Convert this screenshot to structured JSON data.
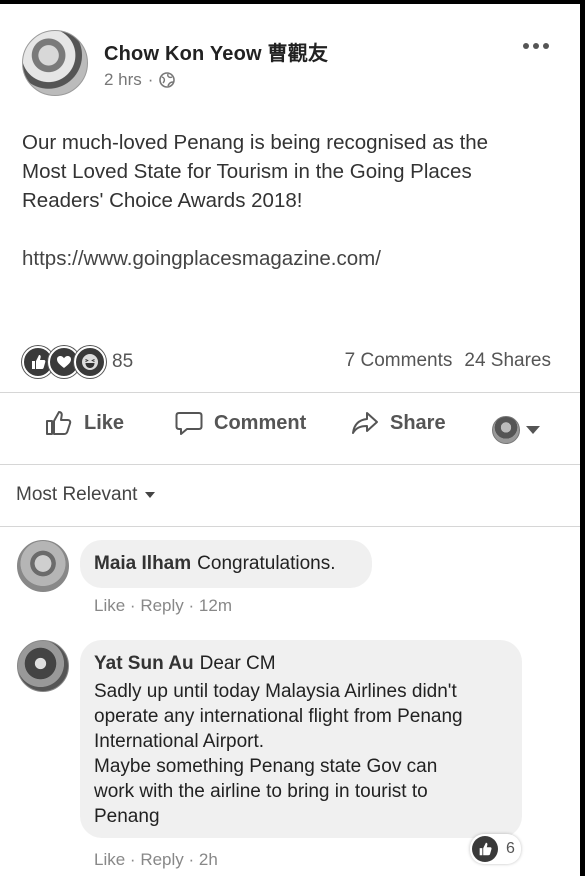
{
  "post": {
    "author": "Chow Kon Yeow 曹觀友",
    "time": "2 hrs",
    "privacy_icon": "globe-icon",
    "text_lines": [
      "Our much-loved Penang is being recognised as the",
      "Most Loved State for Tourism in the Going Places",
      "Readers' Choice Awards 2018!"
    ],
    "link": "https://www.goingplacesmagazine.com/",
    "reaction_icons": [
      "like-reaction-icon",
      "love-reaction-icon",
      "haha-reaction-icon"
    ],
    "reaction_count": "85",
    "comments_count": "7 Comments",
    "shares_count": "24 Shares"
  },
  "actions": {
    "like": "Like",
    "comment": "Comment",
    "share": "Share"
  },
  "sort": {
    "label": "Most Relevant"
  },
  "comments": [
    {
      "name": "Maia Ilham",
      "lines": [
        "Congratulations."
      ],
      "like": "Like",
      "reply": "Reply",
      "time": "12m"
    },
    {
      "name": "Yat Sun Au",
      "first_line": "Dear CM",
      "lines": [
        "Sadly up until today Malaysia Airlines didn't",
        "operate any international flight from Penang",
        "International Airport.",
        "Maybe something Penang state Gov can",
        "work with the airline to bring in tourist to",
        "Penang"
      ],
      "like": "Like",
      "reply": "Reply",
      "time": "2h",
      "like_count": "6"
    }
  ],
  "colors": {
    "bubble": "#f0f0f0",
    "text": "#333333",
    "meta": "#888888",
    "divider": "#d6d6d6"
  }
}
